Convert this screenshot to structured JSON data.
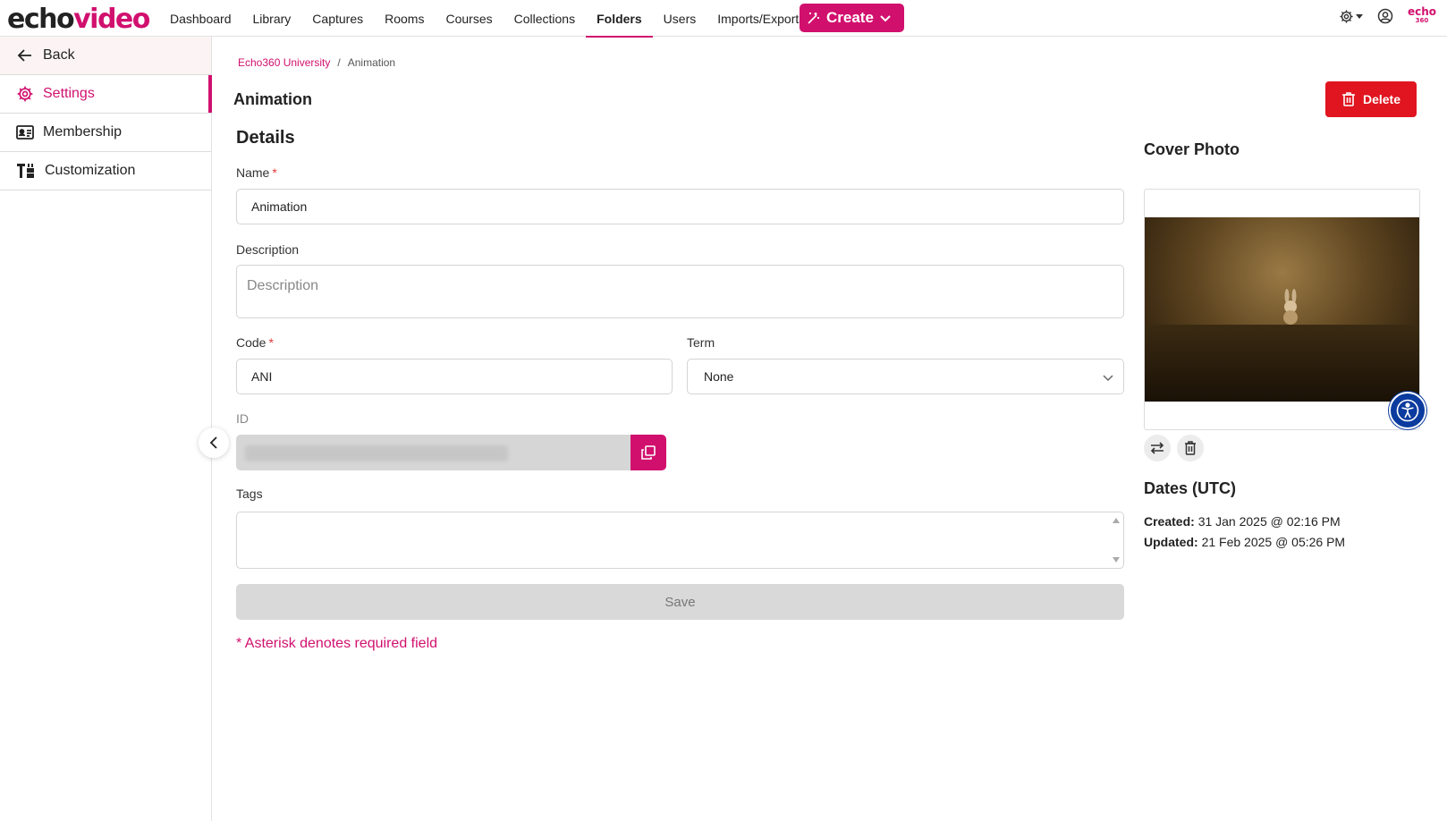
{
  "brand": {
    "logo_part1": "echo",
    "logo_part2": "video",
    "corner_logo_top": "echo",
    "corner_logo_bottom": "360"
  },
  "colors": {
    "accent": "#d1106e",
    "danger": "#e0151f",
    "accessibility": "#0b3b9e"
  },
  "nav": {
    "items": [
      {
        "label": "Dashboard"
      },
      {
        "label": "Library"
      },
      {
        "label": "Captures"
      },
      {
        "label": "Rooms"
      },
      {
        "label": "Courses"
      },
      {
        "label": "Collections"
      },
      {
        "label": "Folders",
        "active": true
      },
      {
        "label": "Users"
      },
      {
        "label": "Imports/Exports"
      }
    ],
    "create_label": "Create"
  },
  "sidebar": {
    "back_label": "Back",
    "items": [
      {
        "label": "Settings",
        "icon": "gear-icon",
        "active": true
      },
      {
        "label": "Membership",
        "icon": "id-card-icon"
      },
      {
        "label": "Customization",
        "icon": "customize-icon"
      }
    ]
  },
  "breadcrumb": {
    "root": "Echo360 University",
    "separator": "/",
    "current": "Animation"
  },
  "page": {
    "title": "Animation",
    "delete_label": "Delete"
  },
  "details": {
    "title": "Details",
    "name_label": "Name",
    "name_value": "Animation",
    "description_label": "Description",
    "description_placeholder": "Description",
    "code_label": "Code",
    "code_value": "ANI",
    "term_label": "Term",
    "term_value": "None",
    "id_label": "ID",
    "tags_label": "Tags",
    "save_label": "Save",
    "required_asterisk": "*",
    "required_note": "* Asterisk denotes required field"
  },
  "cover": {
    "title": "Cover Photo"
  },
  "dates": {
    "title": "Dates (UTC)",
    "created_label": "Created:",
    "created_value": "31 Jan 2025 @ 02:16 PM",
    "updated_label": "Updated:",
    "updated_value": "21 Feb 2025 @ 05:26 PM"
  }
}
